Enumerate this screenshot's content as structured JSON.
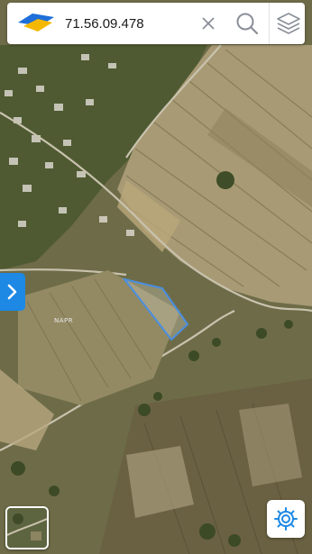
{
  "search": {
    "value": "71.56.09.478"
  },
  "map": {
    "watermark": "NAPR",
    "parcel_outline_color": "#4a8fe0"
  },
  "icons": {
    "logo": "napr-logo-icon",
    "clear": "close-icon",
    "search": "search-icon",
    "layers": "layers-icon",
    "toggle": "chevron-right-icon",
    "settings": "gear-icon"
  },
  "colors": {
    "accent": "#1e88e5",
    "icon_gray": "#8a8f98",
    "logo_blue": "#1e6fd9",
    "logo_yellow": "#f5b800"
  }
}
